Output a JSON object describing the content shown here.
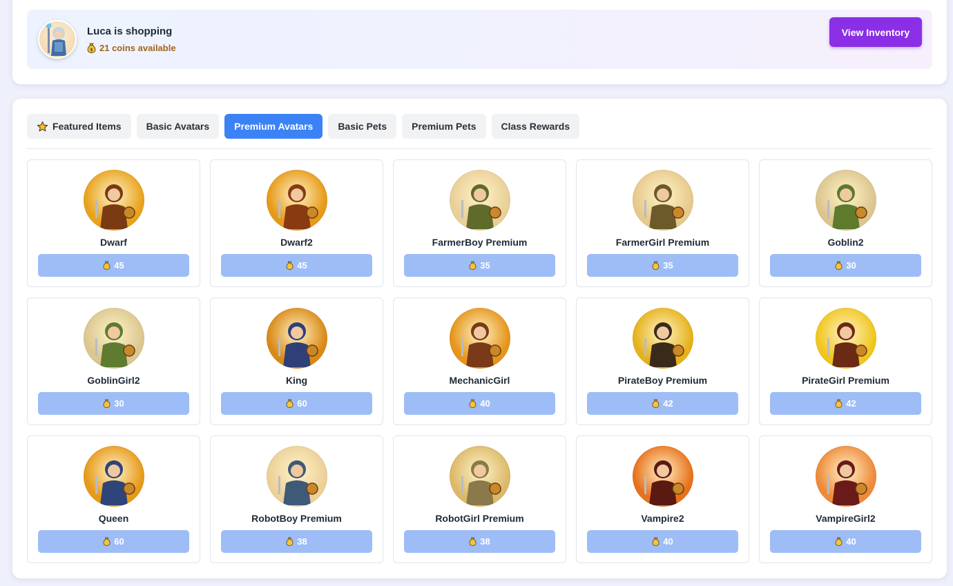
{
  "shopper": {
    "name": "Luca is shopping",
    "coins": "21 coins available",
    "view_inventory": "View Inventory"
  },
  "tabs": [
    {
      "label": "Featured Items",
      "icon": "star-icon",
      "active": false
    },
    {
      "label": "Basic Avatars",
      "active": false
    },
    {
      "label": "Premium Avatars",
      "active": true
    },
    {
      "label": "Basic Pets",
      "active": false
    },
    {
      "label": "Premium Pets",
      "active": false
    },
    {
      "label": "Class Rewards",
      "active": false
    }
  ],
  "items": [
    {
      "name": "Dwarf",
      "price": "45",
      "bg": "#e8a21c",
      "accent": "#7a3b12"
    },
    {
      "name": "Dwarf2",
      "price": "45",
      "bg": "#e69a18",
      "accent": "#8a3a10"
    },
    {
      "name": "FarmerBoy Premium",
      "price": "35",
      "bg": "#e9cf98",
      "accent": "#5f6b2a"
    },
    {
      "name": "FarmerGirl Premium",
      "price": "35",
      "bg": "#e7c98c",
      "accent": "#6c5a2a"
    },
    {
      "name": "Goblin2",
      "price": "30",
      "bg": "#dcc58f",
      "accent": "#5d7a2d"
    },
    {
      "name": "GoblinGirl2",
      "price": "30",
      "bg": "#dbc790",
      "accent": "#5f7b30"
    },
    {
      "name": "King",
      "price": "60",
      "bg": "#d98a16",
      "accent": "#2f3f78"
    },
    {
      "name": "MechanicGirl",
      "price": "40",
      "bg": "#e5951a",
      "accent": "#7a3a18"
    },
    {
      "name": "PirateBoy Premium",
      "price": "42",
      "bg": "#e6b21a",
      "accent": "#3a2a1a"
    },
    {
      "name": "PirateGirl Premium",
      "price": "42",
      "bg": "#f0c61e",
      "accent": "#6a2a14"
    },
    {
      "name": "Queen",
      "price": "60",
      "bg": "#e69a1a",
      "accent": "#2f4478"
    },
    {
      "name": "RobotBoy Premium",
      "price": "38",
      "bg": "#ecd098",
      "accent": "#3e5a78"
    },
    {
      "name": "RobotGirl Premium",
      "price": "38",
      "bg": "#dcb96a",
      "accent": "#8a7a4a"
    },
    {
      "name": "Vampire2",
      "price": "40",
      "bg": "#e8721c",
      "accent": "#5a1a12"
    },
    {
      "name": "VampireGirl2",
      "price": "40",
      "bg": "#ee8a3a",
      "accent": "#6a1a18"
    }
  ]
}
